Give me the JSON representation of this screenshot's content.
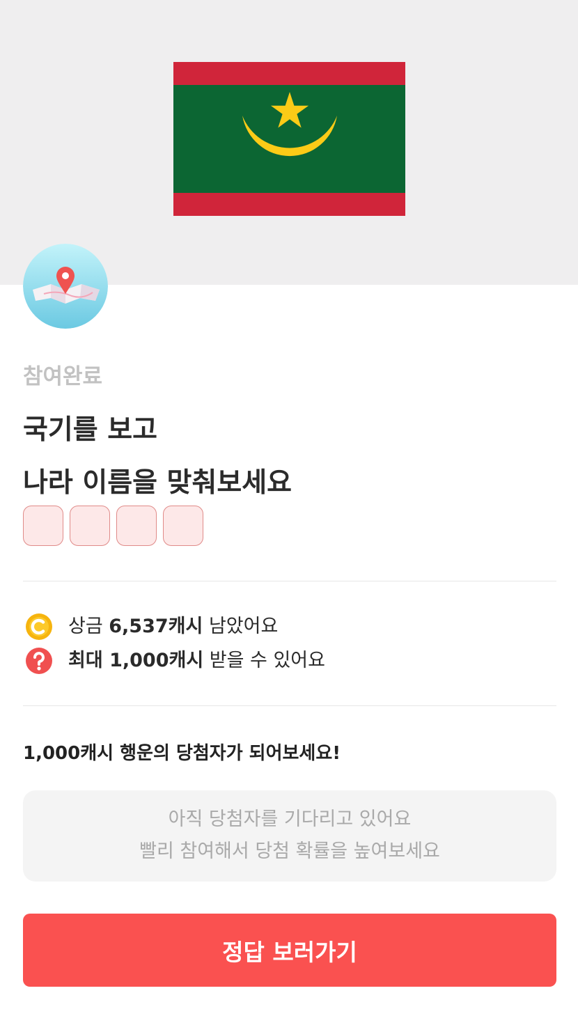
{
  "quiz": {
    "flag_icon": "mauritania-flag",
    "category_icon": "map-pin-icon",
    "status_label": "참여완료",
    "title_line1": "국기를 보고",
    "title_line2": "나라 이름을 맞춰보세요",
    "answer_box_count": 4
  },
  "info": {
    "prize_icon": "coin-icon",
    "prize_prefix": "상금 ",
    "prize_amount": "6,537캐시",
    "prize_suffix": " 남았어요",
    "max_icon": "question-icon",
    "max_amount": "최대 1,000캐시",
    "max_suffix": " 받을 수 있어요"
  },
  "lucky": {
    "heading": "1,000캐시 행운의 당첨자가 되어보세요!",
    "message_line1": "아직 당첨자를 기다리고 있어요",
    "message_line2": "빨리 참여해서 당첨 확률을 높여보세요"
  },
  "cta": {
    "label": "정답 보러가기"
  },
  "colors": {
    "flag_red": "#d0253a",
    "flag_green": "#0c6633",
    "flag_gold": "#fccb17",
    "cta": "#fa5150",
    "answer_box_border": "#e08a88",
    "answer_box_fill": "#fde8e8",
    "coin": "#f6b40e",
    "question": "#f05050"
  }
}
